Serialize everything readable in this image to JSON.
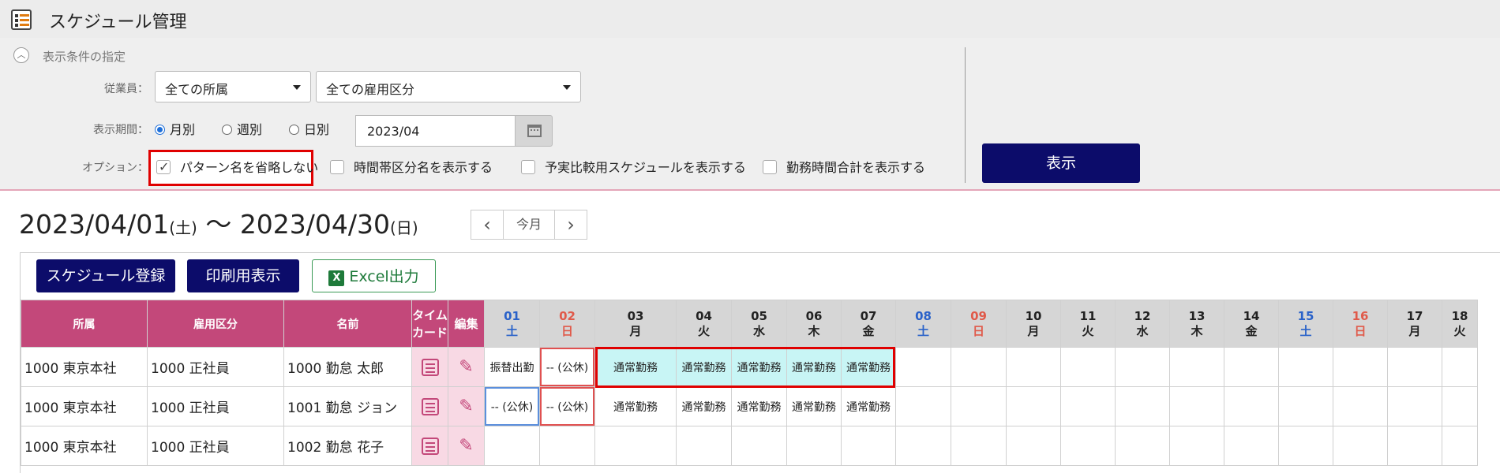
{
  "app": {
    "title": "スケジュール管理",
    "icon": "schedule-app-icon"
  },
  "filter": {
    "heading": "表示条件の指定",
    "employee_label": "従業員：",
    "department_select": "全ての所属",
    "employment_select": "全ての雇用区分",
    "period_label": "表示期間：",
    "period_options": [
      "月別",
      "週別",
      "日別"
    ],
    "period_selected": "月別",
    "date_value": "2023/04",
    "option_label": "オプション：",
    "options": [
      {
        "label": "パターン名を省略しない",
        "checked": true
      },
      {
        "label": "時間帯区分名を表示する",
        "checked": false
      },
      {
        "label": "予実比較用スケジュールを表示する",
        "checked": false
      },
      {
        "label": "勤務時間合計を表示する",
        "checked": false
      }
    ],
    "show_button": "表示"
  },
  "period": {
    "start": "2023/04/01",
    "start_dow": "(土)",
    "separator": "〜",
    "end": "2023/04/30",
    "end_dow": "(日)",
    "prev": "‹",
    "today": "今月",
    "next": "›"
  },
  "actions": {
    "register": "スケジュール登録",
    "print": "印刷用表示",
    "excel": "Excel出力"
  },
  "table": {
    "headers": {
      "department": "所属",
      "employment": "雇用区分",
      "name": "名前",
      "timecard": "タイム\nカード",
      "edit": "編集"
    },
    "days": [
      {
        "d": "01",
        "w": "土",
        "t": "sat"
      },
      {
        "d": "02",
        "w": "日",
        "t": "sun"
      },
      {
        "d": "03",
        "w": "月",
        "t": ""
      },
      {
        "d": "04",
        "w": "火",
        "t": ""
      },
      {
        "d": "05",
        "w": "水",
        "t": ""
      },
      {
        "d": "06",
        "w": "木",
        "t": ""
      },
      {
        "d": "07",
        "w": "金",
        "t": ""
      },
      {
        "d": "08",
        "w": "土",
        "t": "sat"
      },
      {
        "d": "09",
        "w": "日",
        "t": "sun"
      },
      {
        "d": "10",
        "w": "月",
        "t": ""
      },
      {
        "d": "11",
        "w": "火",
        "t": ""
      },
      {
        "d": "12",
        "w": "水",
        "t": ""
      },
      {
        "d": "13",
        "w": "木",
        "t": ""
      },
      {
        "d": "14",
        "w": "金",
        "t": ""
      },
      {
        "d": "15",
        "w": "土",
        "t": "sat"
      },
      {
        "d": "16",
        "w": "日",
        "t": "sun"
      },
      {
        "d": "17",
        "w": "月",
        "t": ""
      },
      {
        "d": "18",
        "w": "火",
        "t": ""
      }
    ],
    "rows": [
      {
        "department": "1000 東京本社",
        "employment": "1000 正社員",
        "name": "1000 勤怠 太郎",
        "cells": [
          "振替出勤",
          "-- (公休)",
          "通常勤務",
          "通常勤務",
          "通常勤務",
          "通常勤務",
          "通常勤務",
          "",
          "",
          "",
          "",
          "",
          "",
          "",
          "",
          "",
          "",
          ""
        ]
      },
      {
        "department": "1000 東京本社",
        "employment": "1000 正社員",
        "name": "1001 勤怠 ジョン",
        "cells": [
          "-- (公休)",
          "-- (公休)",
          "通常勤務",
          "通常勤務",
          "通常勤務",
          "通常勤務",
          "通常勤務",
          "",
          "",
          "",
          "",
          "",
          "",
          "",
          "",
          "",
          "",
          ""
        ]
      },
      {
        "department": "1000 東京本社",
        "employment": "1000 正社員",
        "name": "1002 勤怠 花子",
        "cells": [
          "",
          "",
          "",
          "",
          "",
          "",
          "",
          "",
          "",
          "",
          "",
          "",
          "",
          "",
          "",
          "",
          "",
          ""
        ]
      }
    ]
  },
  "colors": {
    "navy": "#0c0c6a",
    "header_pink": "#c3487a",
    "highlight_red": "#e00000",
    "cyan_cell": "#c8f5f5"
  }
}
